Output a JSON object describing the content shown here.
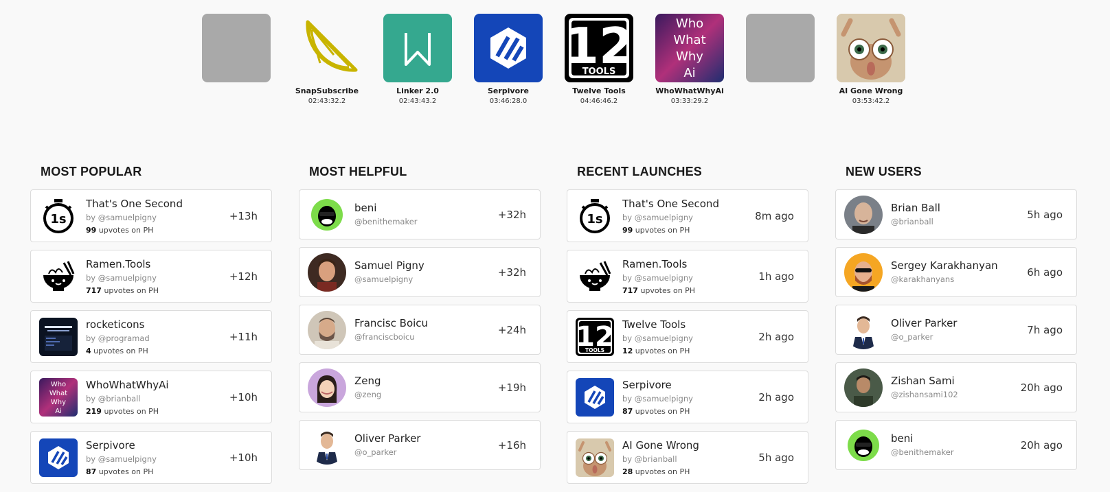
{
  "top_timers": [
    {
      "name": "",
      "time": ""
    },
    {
      "name": "SnapSubscribe",
      "time": "02:43:32.2"
    },
    {
      "name": "Linker 2.0",
      "time": "02:43:43.2"
    },
    {
      "name": "Serpivore",
      "time": "03:46:28.0"
    },
    {
      "name": "Twelve Tools",
      "time": "04:46:46.2"
    },
    {
      "name": "WhoWhatWhyAi",
      "time": "03:33:29.2"
    },
    {
      "name": "",
      "time": ""
    },
    {
      "name": "AI Gone Wrong",
      "time": "03:53:42.2"
    }
  ],
  "thumb_text": {
    "twelve_num": "12",
    "twelve_word": "TOOLS",
    "www": [
      "Who",
      "What",
      "Why",
      "Ai"
    ],
    "one_second": "1s"
  },
  "most_popular": {
    "heading": "MOST POPULAR",
    "items": [
      {
        "title": "That's One Second",
        "by": "by @samuelpigny",
        "upvotes": "99",
        "upvotes_suffix": " upvotes on PH",
        "right": "+13h",
        "icon": "stopwatch-icon"
      },
      {
        "title": "Ramen.Tools",
        "by": "by @samuelpigny",
        "upvotes": "717",
        "upvotes_suffix": " upvotes on PH",
        "right": "+12h",
        "icon": "ramen-bowl-icon"
      },
      {
        "title": "rocketicons",
        "by": "by @programad",
        "upvotes": "4",
        "upvotes_suffix": " upvotes on PH",
        "right": "+11h",
        "icon": "rocketicons-screenshot"
      },
      {
        "title": "WhoWhatWhyAi",
        "by": "by @brianball",
        "upvotes": "219",
        "upvotes_suffix": " upvotes on PH",
        "right": "+10h",
        "icon": "whowhatwhyai-logo"
      },
      {
        "title": "Serpivore",
        "by": "by @samuelpigny",
        "upvotes": "87",
        "upvotes_suffix": " upvotes on PH",
        "right": "+10h",
        "icon": "serpivore-logo"
      }
    ]
  },
  "most_helpful": {
    "heading": "MOST HELPFUL",
    "items": [
      {
        "name": "beni",
        "handle": "@benithemaker",
        "right": "+32h"
      },
      {
        "name": "Samuel Pigny",
        "handle": "@samuelpigny",
        "right": "+32h"
      },
      {
        "name": "Francisc Boicu",
        "handle": "@franciscboicu",
        "right": "+24h"
      },
      {
        "name": "Zeng",
        "handle": "@zeng",
        "right": "+19h"
      },
      {
        "name": "Oliver Parker",
        "handle": "@o_parker",
        "right": "+16h"
      }
    ]
  },
  "recent_launches": {
    "heading": "RECENT LAUNCHES",
    "items": [
      {
        "title": "That's One Second",
        "by": "by @samuelpigny",
        "upvotes": "99",
        "upvotes_suffix": " upvotes on PH",
        "right": "8m ago",
        "icon": "stopwatch-icon"
      },
      {
        "title": "Ramen.Tools",
        "by": "by @samuelpigny",
        "upvotes": "717",
        "upvotes_suffix": " upvotes on PH",
        "right": "1h ago",
        "icon": "ramen-bowl-icon"
      },
      {
        "title": "Twelve Tools",
        "by": "by @samuelpigny",
        "upvotes": "12",
        "upvotes_suffix": " upvotes on PH",
        "right": "2h ago",
        "icon": "twelve-tools-logo"
      },
      {
        "title": "Serpivore",
        "by": "by @samuelpigny",
        "upvotes": "87",
        "upvotes_suffix": " upvotes on PH",
        "right": "2h ago",
        "icon": "serpivore-logo"
      },
      {
        "title": "AI Gone Wrong",
        "by": "by @brianball",
        "upvotes": "28",
        "upvotes_suffix": " upvotes on PH",
        "right": "5h ago",
        "icon": "ai-gone-wrong-image"
      }
    ]
  },
  "new_users": {
    "heading": "NEW USERS",
    "items": [
      {
        "name": "Brian Ball",
        "handle": "@brianball",
        "right": "5h ago"
      },
      {
        "name": "Sergey Karakhanyan",
        "handle": "@karakhanyans",
        "right": "6h ago"
      },
      {
        "name": "Oliver Parker",
        "handle": "@o_parker",
        "right": "7h ago"
      },
      {
        "name": "Zishan Sami",
        "handle": "@zishansami102",
        "right": "20h ago"
      },
      {
        "name": "beni",
        "handle": "@benithemaker",
        "right": "20h ago"
      }
    ]
  },
  "colors": {
    "linker_green": "#35a88f",
    "serpivore_blue": "#1446b8",
    "lemon_yellow": "#c8b400",
    "beni_green": "#7ddc4a",
    "zeng_purple": "#c9a6dc",
    "sergey_orange": "#f5a623"
  }
}
